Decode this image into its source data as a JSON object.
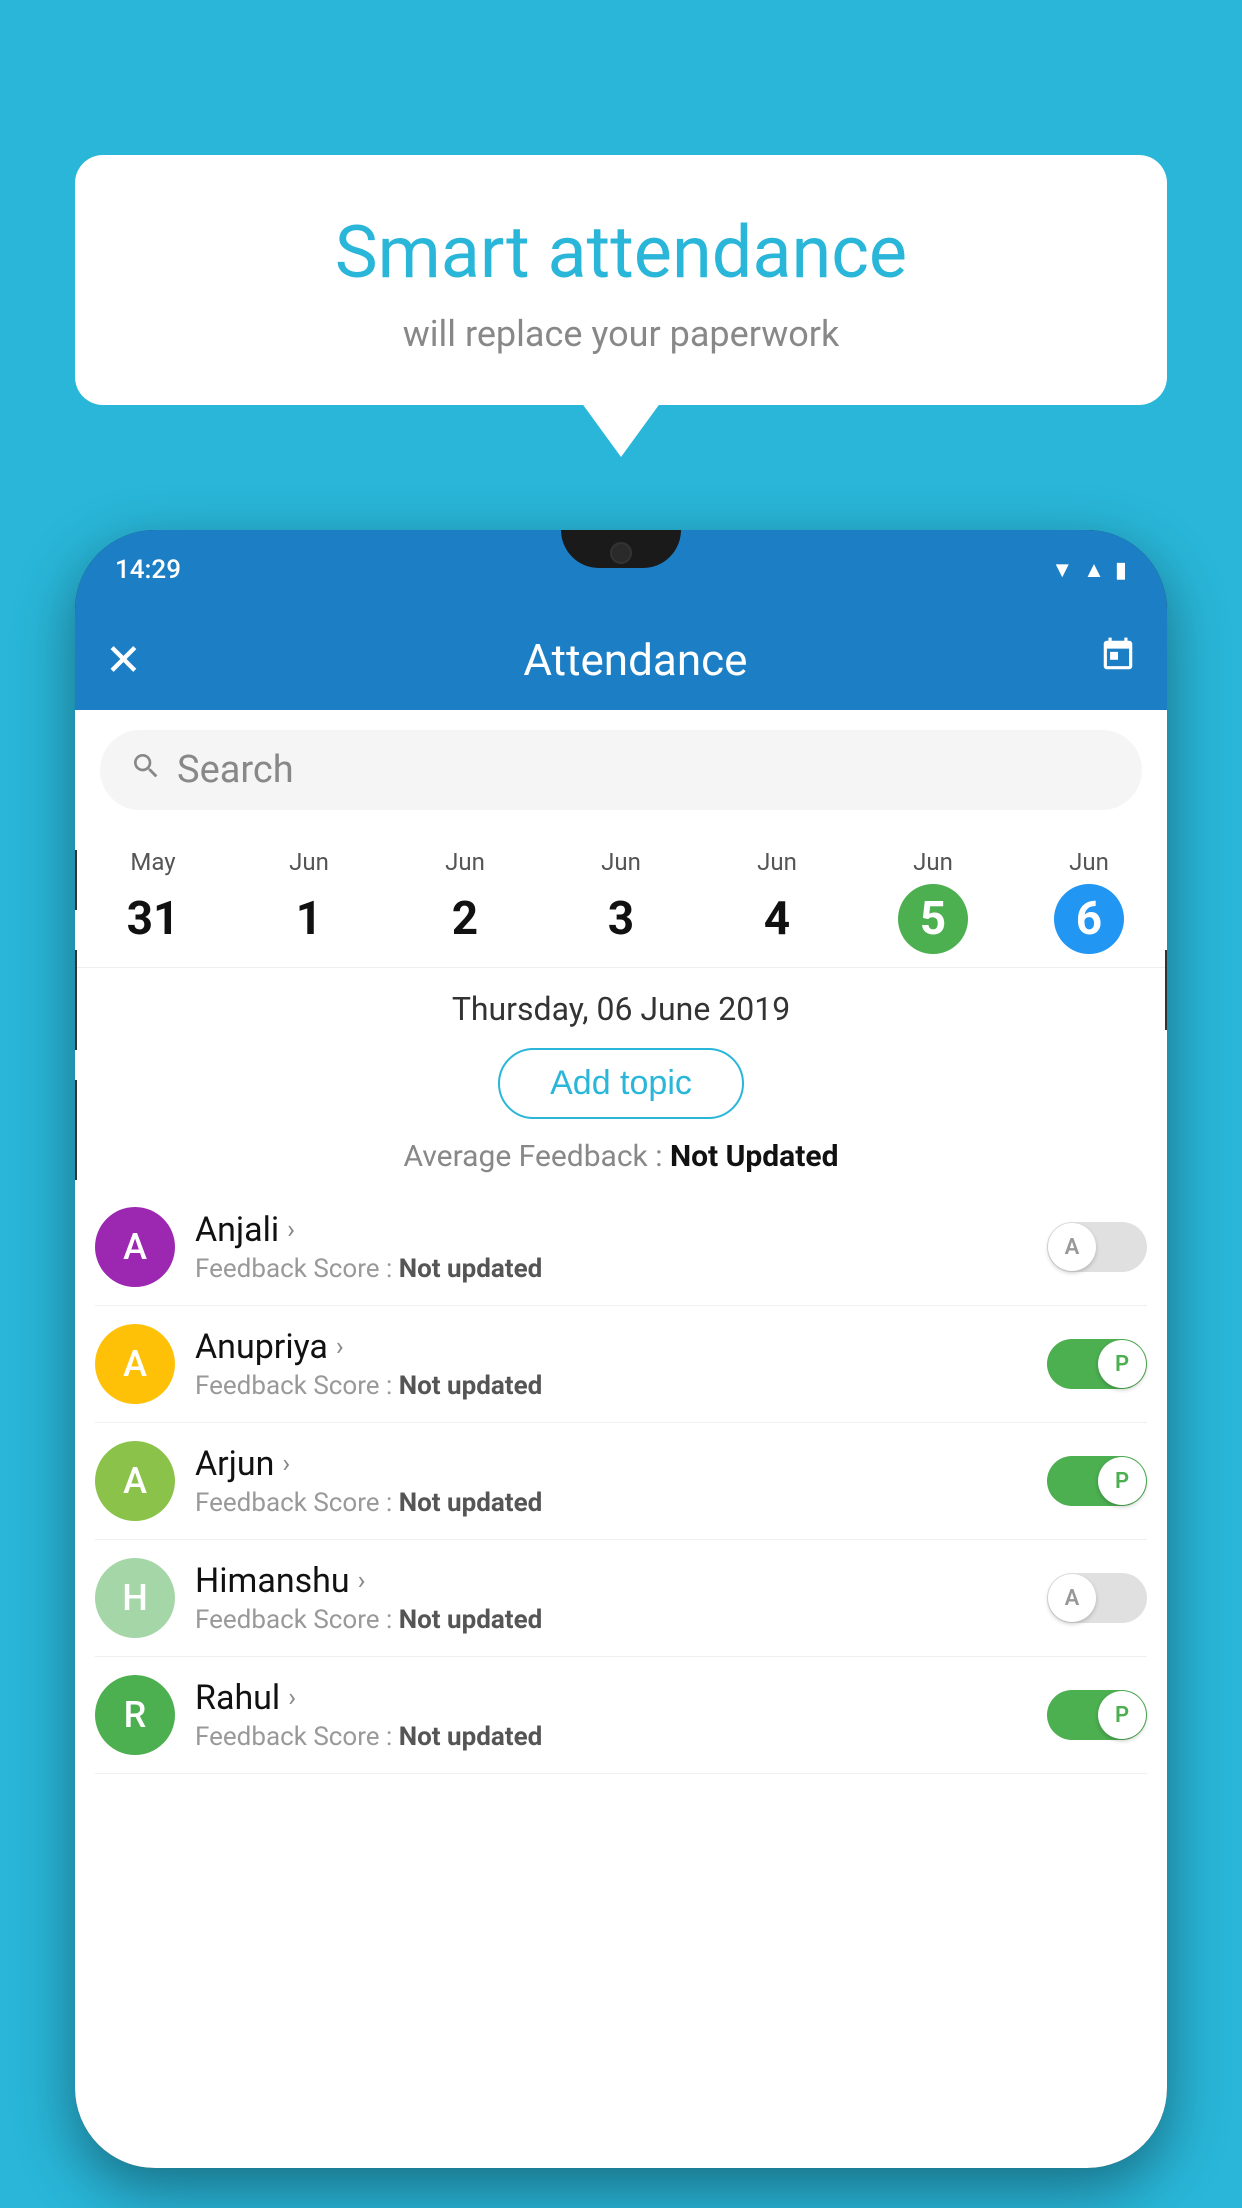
{
  "background_color": "#29B6D8",
  "speech_bubble": {
    "title": "Smart attendance",
    "subtitle": "will replace your paperwork"
  },
  "status_bar": {
    "time": "14:29"
  },
  "app_bar": {
    "title": "Attendance",
    "close_icon": "✕",
    "calendar_icon": "📅"
  },
  "search": {
    "placeholder": "Search"
  },
  "calendar": {
    "days": [
      {
        "month": "May",
        "date": "31",
        "state": "normal"
      },
      {
        "month": "Jun",
        "date": "1",
        "state": "normal"
      },
      {
        "month": "Jun",
        "date": "2",
        "state": "normal"
      },
      {
        "month": "Jun",
        "date": "3",
        "state": "normal"
      },
      {
        "month": "Jun",
        "date": "4",
        "state": "normal"
      },
      {
        "month": "Jun",
        "date": "5",
        "state": "today"
      },
      {
        "month": "Jun",
        "date": "6",
        "state": "selected"
      }
    ]
  },
  "selected_date": "Thursday, 06 June 2019",
  "add_topic_label": "Add topic",
  "feedback_summary": {
    "label": "Average Feedback :",
    "value": "Not Updated"
  },
  "students": [
    {
      "name": "Anjali",
      "avatar_letter": "A",
      "avatar_color": "#9C27B0",
      "feedback_label": "Feedback Score :",
      "feedback_value": "Not updated",
      "toggle": "off",
      "toggle_letter": "A"
    },
    {
      "name": "Anupriya",
      "avatar_letter": "A",
      "avatar_color": "#FFC107",
      "feedback_label": "Feedback Score :",
      "feedback_value": "Not updated",
      "toggle": "on",
      "toggle_letter": "P"
    },
    {
      "name": "Arjun",
      "avatar_letter": "A",
      "avatar_color": "#8BC34A",
      "feedback_label": "Feedback Score :",
      "feedback_value": "Not updated",
      "toggle": "on",
      "toggle_letter": "P"
    },
    {
      "name": "Himanshu",
      "avatar_letter": "H",
      "avatar_color": "#A5D6A7",
      "feedback_label": "Feedback Score :",
      "feedback_value": "Not updated",
      "toggle": "off",
      "toggle_letter": "A"
    },
    {
      "name": "Rahul",
      "avatar_letter": "R",
      "avatar_color": "#4CAF50",
      "feedback_label": "Feedback Score :",
      "feedback_value": "Not updated",
      "toggle": "on",
      "toggle_letter": "P"
    }
  ]
}
